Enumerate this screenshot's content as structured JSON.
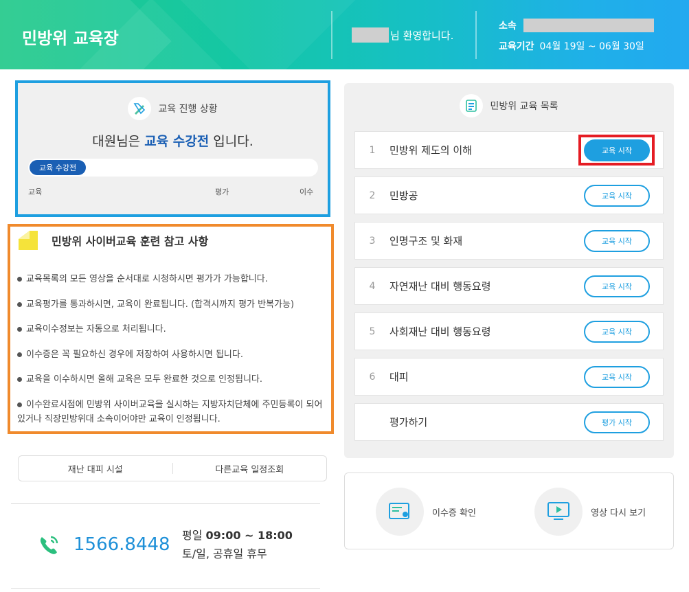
{
  "header": {
    "site_title": "민방위 교육장",
    "welcome_suffix": "님 환영합니다.",
    "affiliation_label": "소속",
    "period_label": "교육기간",
    "period_value": "04월 19일 ~ 06월 30일"
  },
  "progress": {
    "heading": "교육 진행 상황",
    "msg_prefix": "대원님은 ",
    "msg_status": "교육 수강전",
    "msg_suffix": " 입니다.",
    "bar_label": "교육 수강전",
    "bar_fraction": 0,
    "stage_labels": [
      "교육",
      "평가",
      "이수"
    ]
  },
  "notice": {
    "title": "민방위 사이버교육 훈련 참고 사항",
    "items": [
      "교육목록의 모든 영상을 순서대로 시청하시면 평가가 가능합니다.",
      "교육평가를 통과하시면, 교육이 완료됩니다. (합격시까지 평가 반복가능)",
      "교육이수정보는 자동으로 처리됩니다.",
      "이수증은 꼭 필요하신 경우에 저장하여 사용하시면 됩니다.",
      "교육을 이수하시면 올해 교육은 모두 완료한 것으로 인정됩니다.",
      "이수완료시점에 민방위 사이버교육을 실시하는 지방자치단체에 주민등록이 되어 있거나 직장민방위대 소속이어야만 교육이 인정됩니다."
    ]
  },
  "shortcuts": {
    "facility": "재난 대피 시설",
    "schedule": "다른교육 일정조회"
  },
  "contact": {
    "phone": "1566.8448",
    "weekday_label": "평일 ",
    "weekday_hours": "09:00 ~ 18:00",
    "weekend": "토/일, 공휴일 휴무"
  },
  "courses": {
    "heading": "민방위 교육 목록",
    "items": [
      {
        "num": "1",
        "title": "민방위 제도의 이해",
        "button": "교육 시작"
      },
      {
        "num": "2",
        "title": "민방공",
        "button": "교육 시작"
      },
      {
        "num": "3",
        "title": "인명구조 및 화재",
        "button": "교육 시작"
      },
      {
        "num": "4",
        "title": "자연재난 대비 행동요령",
        "button": "교육 시작"
      },
      {
        "num": "5",
        "title": "사회재난 대비 행동요령",
        "button": "교육 시작"
      },
      {
        "num": "6",
        "title": "대피",
        "button": "교육 시작"
      },
      {
        "num": "",
        "title": "평가하기",
        "button": "평가 시작"
      }
    ]
  },
  "actions": {
    "certificate": "이수증 확인",
    "replay": "영상 다시 보기"
  },
  "colors": {
    "accent_blue": "#1e9fe0",
    "status_navy": "#1a5fb4",
    "highlight_red": "#e51c23",
    "notice_orange": "#f08a2c"
  }
}
